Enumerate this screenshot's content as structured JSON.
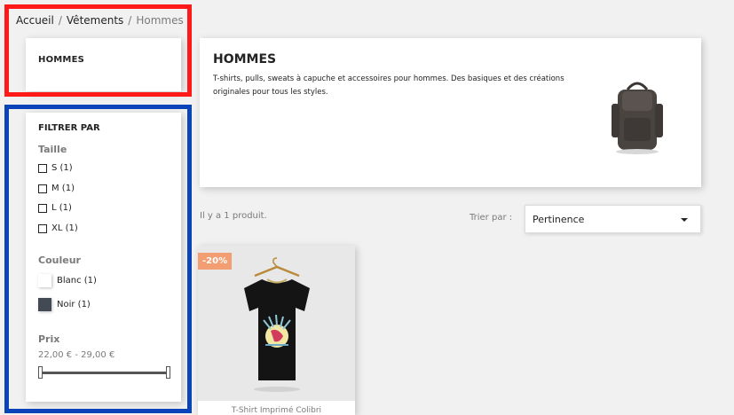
{
  "breadcrumb": {
    "items": [
      "Accueil",
      "Vêtements"
    ],
    "current": "Hommes",
    "separator": "/"
  },
  "category_block": {
    "title": "HOMMES"
  },
  "filters": {
    "header": "FILTRER PAR",
    "size": {
      "title": "Taille",
      "options": [
        "S (1)",
        "M (1)",
        "L (1)",
        "XL (1)"
      ]
    },
    "color": {
      "title": "Couleur",
      "options": [
        {
          "label": "Blanc (1)",
          "swatch": "#ffffff"
        },
        {
          "label": "Noir (1)",
          "swatch": "#434a54"
        }
      ]
    },
    "price": {
      "title": "Prix",
      "range_text": "22,00 € - 29,00 €"
    }
  },
  "category_header": {
    "title": "HOMMES",
    "description": "T-shirts, pulls, sweats à capuche et accessoires pour hommes. Des basiques et des créations originales pour tous les styles.",
    "image_icon": "backpack-image"
  },
  "listing": {
    "count_text": "Il y a 1 produit.",
    "sort_label": "Trier par :",
    "sort_value": "Pertinence"
  },
  "products": [
    {
      "discount": "-20%",
      "name": "T-Shirt Imprimé Colibri",
      "image_icon": "tshirt-image"
    }
  ],
  "colors": {
    "discount_badge": "#f39d72",
    "highlight_red": "#ff1a1a",
    "highlight_blue": "#0b43b8"
  }
}
